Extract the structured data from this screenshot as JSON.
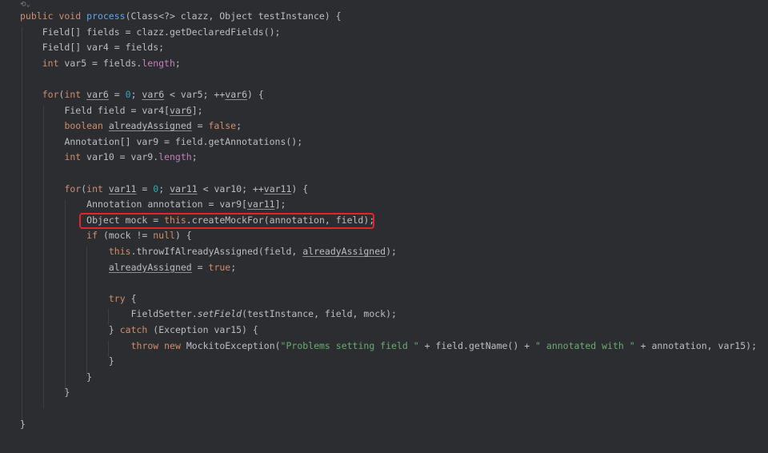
{
  "gutter": {
    "marker": "⟲⌄"
  },
  "lines": [
    [
      [
        "kw",
        "public void "
      ],
      [
        "fn",
        "process"
      ],
      [
        "p",
        "(Class<?> clazz, Object testInstance) {"
      ]
    ],
    [
      [
        "p",
        "Field[] fields = clazz.getDeclaredFields();"
      ]
    ],
    [
      [
        "p",
        "Field[] var4 = fields;"
      ]
    ],
    [
      [
        "kw",
        "int "
      ],
      [
        "p",
        "var5 = fields."
      ],
      [
        "fld",
        "length"
      ],
      [
        "p",
        ";"
      ]
    ],
    [],
    [
      [
        "kw",
        "for"
      ],
      [
        "p",
        "("
      ],
      [
        "kw",
        "int "
      ],
      [
        "ul",
        "var6"
      ],
      [
        "p",
        " = "
      ],
      [
        "num",
        "0"
      ],
      [
        "p",
        "; "
      ],
      [
        "ul",
        "var6"
      ],
      [
        "p",
        " < var5; ++"
      ],
      [
        "ul",
        "var6"
      ],
      [
        "p",
        ") {"
      ]
    ],
    [
      [
        "p",
        "Field field = var4["
      ],
      [
        "ul",
        "var6"
      ],
      [
        "p",
        "];"
      ]
    ],
    [
      [
        "kw",
        "boolean "
      ],
      [
        "ul",
        "alreadyAssigned"
      ],
      [
        "p",
        " = "
      ],
      [
        "kw",
        "false"
      ],
      [
        "p",
        ";"
      ]
    ],
    [
      [
        "p",
        "Annotation[] var9 = field.getAnnotations();"
      ]
    ],
    [
      [
        "kw",
        "int "
      ],
      [
        "p",
        "var10 = var9."
      ],
      [
        "fld",
        "length"
      ],
      [
        "p",
        ";"
      ]
    ],
    [],
    [
      [
        "kw",
        "for"
      ],
      [
        "p",
        "("
      ],
      [
        "kw",
        "int "
      ],
      [
        "ul",
        "var11"
      ],
      [
        "p",
        " = "
      ],
      [
        "num",
        "0"
      ],
      [
        "p",
        "; "
      ],
      [
        "ul",
        "var11"
      ],
      [
        "p",
        " < var10; ++"
      ],
      [
        "ul",
        "var11"
      ],
      [
        "p",
        ") {"
      ]
    ],
    [
      [
        "p",
        "Annotation annotation = var9["
      ],
      [
        "ul",
        "var11"
      ],
      [
        "p",
        "];"
      ]
    ],
    [
      [
        "p",
        "Object mock = "
      ],
      [
        "kw",
        "this"
      ],
      [
        "p",
        ".createMockFor(annotation, field);"
      ]
    ],
    [
      [
        "kw",
        "if "
      ],
      [
        "p",
        "(mock != "
      ],
      [
        "kw",
        "null"
      ],
      [
        "p",
        ") {"
      ]
    ],
    [
      [
        "kw",
        "this"
      ],
      [
        "p",
        ".throwIfAlreadyAssigned(field, "
      ],
      [
        "ul",
        "alreadyAssigned"
      ],
      [
        "p",
        ");"
      ]
    ],
    [
      [
        "ul",
        "alreadyAssigned"
      ],
      [
        "p",
        " = "
      ],
      [
        "kw",
        "true"
      ],
      [
        "p",
        ";"
      ]
    ],
    [],
    [
      [
        "kw",
        "try "
      ],
      [
        "p",
        "{"
      ]
    ],
    [
      [
        "p",
        "FieldSetter."
      ],
      [
        "ital",
        "setField"
      ],
      [
        "p",
        "(testInstance, field, mock);"
      ]
    ],
    [
      [
        "p",
        "} "
      ],
      [
        "kw",
        "catch "
      ],
      [
        "p",
        "(Exception var15) {"
      ]
    ],
    [
      [
        "kw",
        "throw new "
      ],
      [
        "p",
        "MockitoException("
      ],
      [
        "str",
        "\"Problems setting field \""
      ],
      [
        "p",
        " + field.getName() + "
      ],
      [
        "str",
        "\" annotated with \""
      ],
      [
        "p",
        " + annotation, var15);"
      ]
    ],
    [
      [
        "p",
        "}"
      ]
    ],
    [
      [
        "p",
        "}"
      ]
    ],
    [
      [
        "p",
        "}"
      ]
    ],
    [],
    [
      [
        "p",
        "}"
      ]
    ]
  ]
}
